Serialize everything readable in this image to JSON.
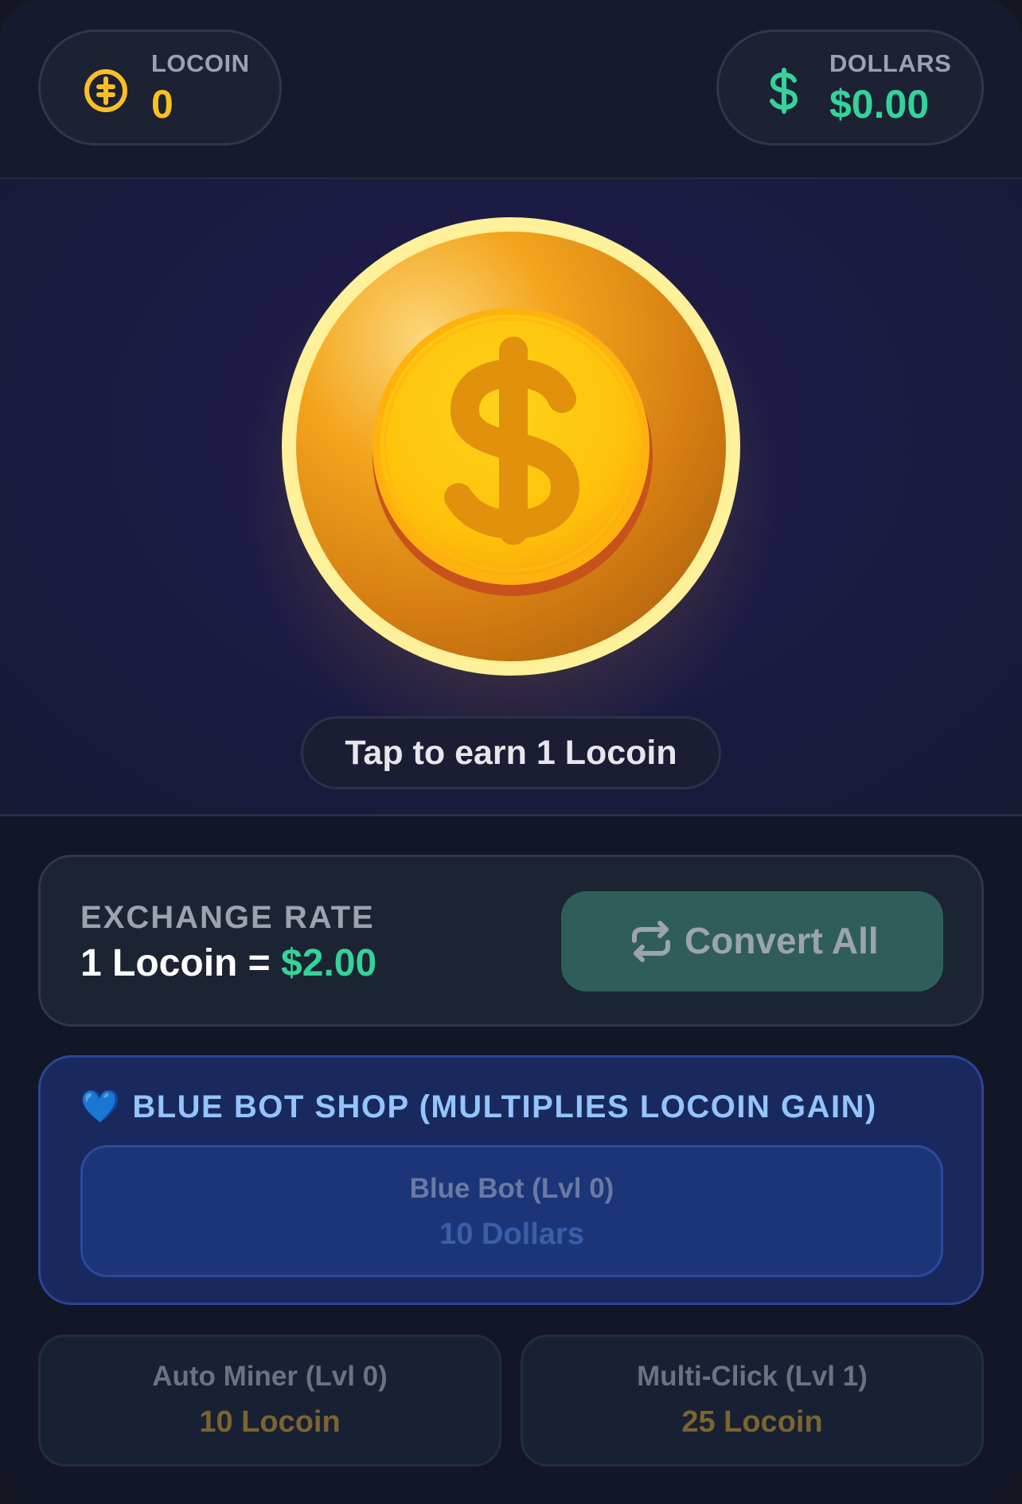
{
  "balances": {
    "locoin": {
      "label": "LOCOIN",
      "value": "0",
      "icon": "locoin-icon",
      "color": "#fbbf24"
    },
    "dollars": {
      "label": "DOLLARS",
      "value": "$0.00",
      "icon": "dollar-icon",
      "color": "#34d399"
    }
  },
  "tap": {
    "coin_icon": "dollar-coin-icon",
    "hint": "Tap to earn 1 Locoin"
  },
  "exchange": {
    "label": "EXCHANGE RATE",
    "rate_prefix": "1 Locoin = ",
    "rate_value": "$2.00",
    "convert_label": "Convert All",
    "convert_icon": "swap-arrows-icon"
  },
  "shop": {
    "title": "BLUE BOT SHOP (MULTIPLIES LOCOIN GAIN)",
    "title_icon": "blue-heart-icon",
    "title_emoji": "💙",
    "item": {
      "name": "Blue Bot (Lvl 0)",
      "price": "10 Dollars"
    }
  },
  "upgrades": [
    {
      "name": "Auto Miner (Lvl 0)",
      "price": "10 Locoin"
    },
    {
      "name": "Multi-Click (Lvl 1)",
      "price": "25 Locoin"
    }
  ],
  "colors": {
    "background": "#131627",
    "gold": "#fbbf24",
    "green": "#34d399",
    "blue_accent": "#93c5fd"
  }
}
